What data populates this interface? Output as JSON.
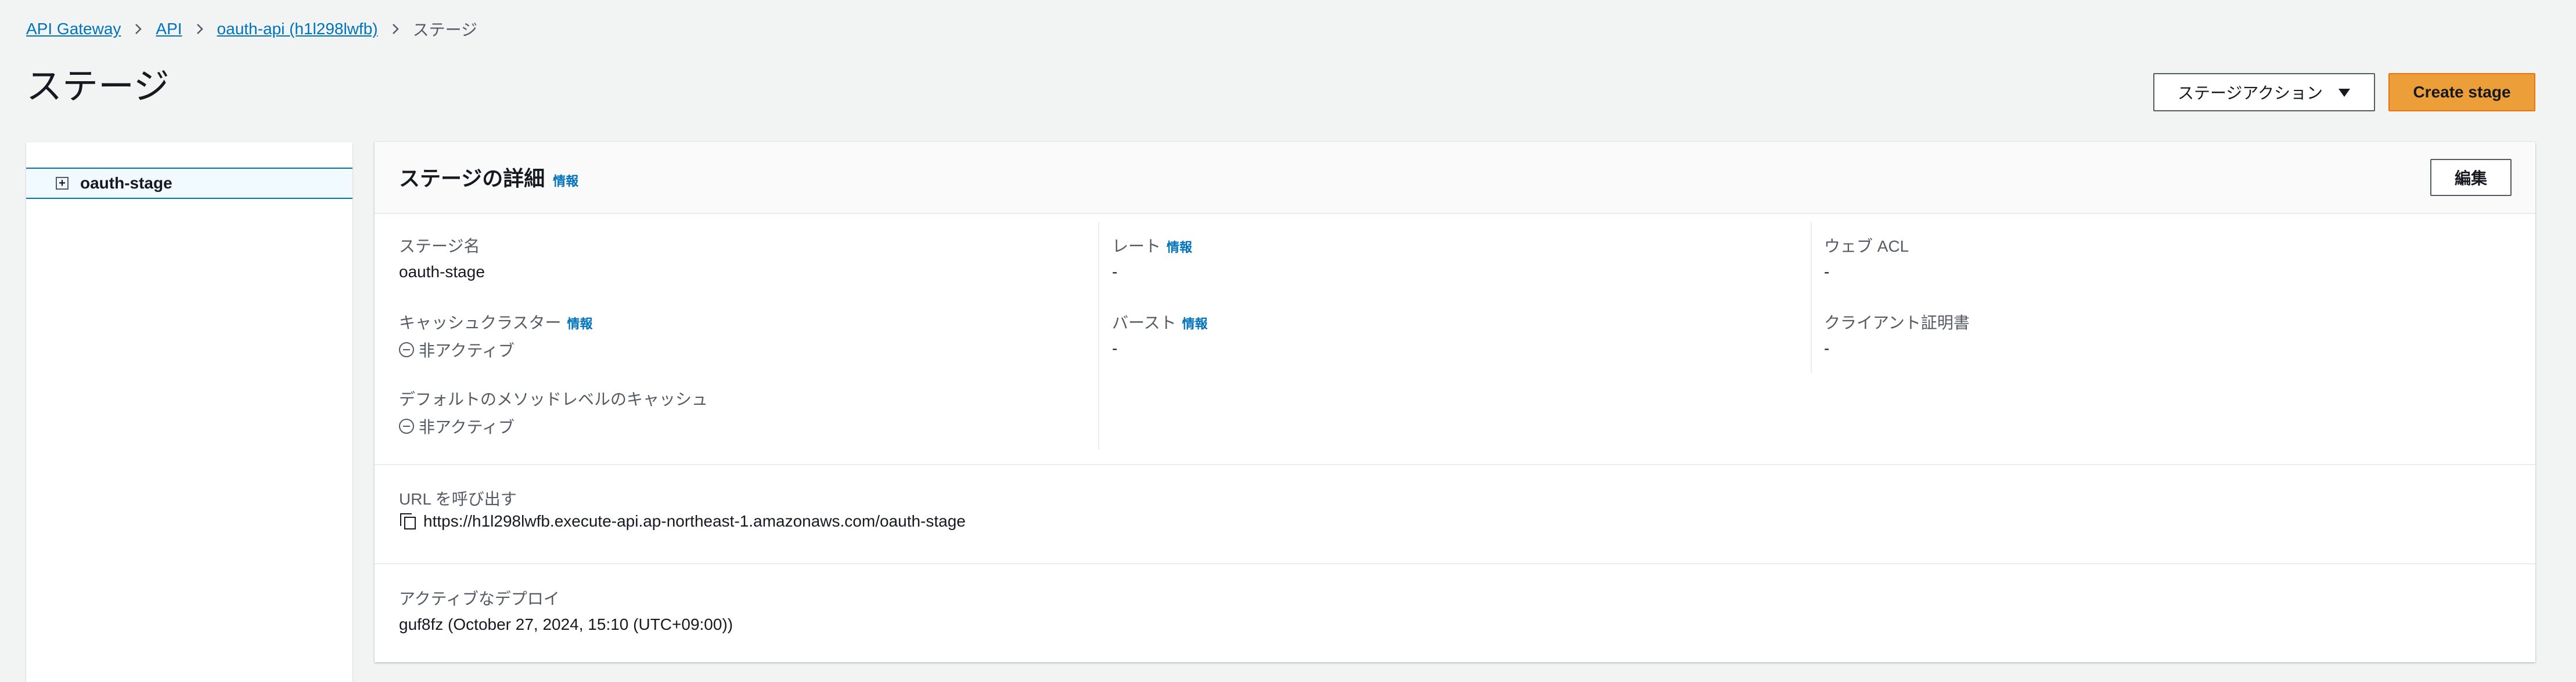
{
  "breadcrumb": {
    "items": [
      "API Gateway",
      "API",
      "oauth-api (h1l298lwfb)"
    ],
    "current": "ステージ"
  },
  "page": {
    "title": "ステージ"
  },
  "header": {
    "stage_actions_label": "ステージアクション",
    "create_stage_label": "Create stage"
  },
  "tree": {
    "stage_name": "oauth-stage",
    "expander_symbol": "+"
  },
  "detail": {
    "title": "ステージの詳細",
    "info_label": "情報",
    "edit_label": "編集",
    "fields": {
      "stage_name": {
        "label": "ステージ名",
        "value": "oauth-stage"
      },
      "cache_cluster": {
        "label": "キャッシュクラスター",
        "value": "非アクティブ"
      },
      "default_cache": {
        "label": "デフォルトのメソッドレベルのキャッシュ",
        "value": "非アクティブ"
      },
      "rate": {
        "label": "レート",
        "value": "-"
      },
      "burst": {
        "label": "バースト",
        "value": "-"
      },
      "web_acl": {
        "label": "ウェブ ACL",
        "value": "-"
      },
      "client_cert": {
        "label": "クライアント証明書",
        "value": "-"
      }
    },
    "invoke_url": {
      "label": "URL を呼び出す",
      "value": "https://h1l298lwfb.execute-api.ap-northeast-1.amazonaws.com/oauth-stage"
    },
    "active_deployment": {
      "label": "アクティブなデプロイ",
      "value": "guf8fz (October 27, 2024, 15:10 (UTC+09:00))"
    }
  },
  "colors": {
    "link": "#0073bb",
    "primary_button": "#ec9e39",
    "page_bg": "#f2f3f3",
    "text": "#16191f",
    "muted": "#545b64"
  }
}
